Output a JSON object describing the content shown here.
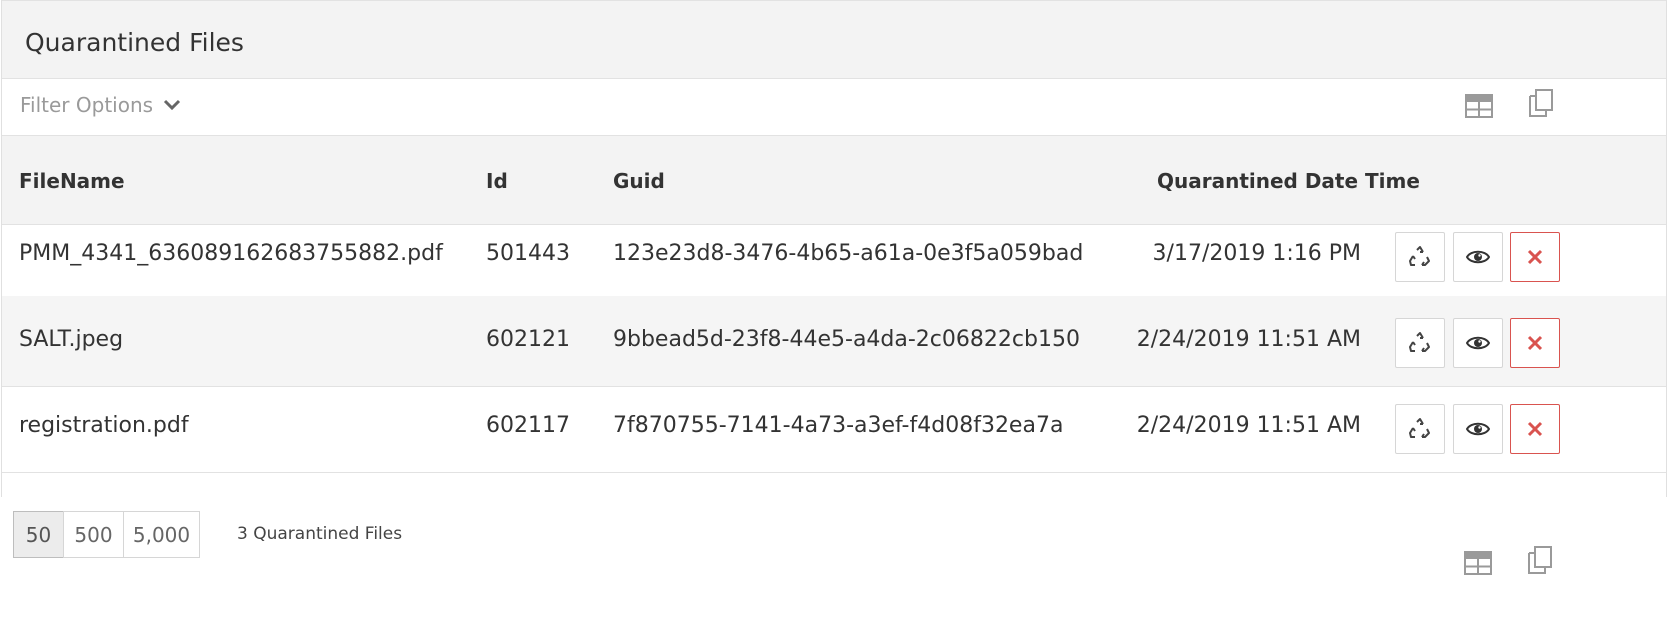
{
  "panel": {
    "title": "Quarantined Files",
    "filter_label": "Filter Options"
  },
  "table": {
    "columns": {
      "filename": "FileName",
      "id": "Id",
      "guid": "Guid",
      "date": "Quarantined Date Time"
    },
    "rows": [
      {
        "filename": "PMM_4341_636089162683755882.pdf",
        "id": "501443",
        "guid": "123e23d8-3476-4b65-a61a-0e3f5a059bad",
        "date": "3/17/2019 1:16 PM"
      },
      {
        "filename": "SALT.jpeg",
        "id": "602121",
        "guid": "9bbead5d-23f8-44e5-a4da-2c06822cb150",
        "date": "2/24/2019 11:51 AM"
      },
      {
        "filename": "registration.pdf",
        "id": "602117",
        "guid": "7f870755-7141-4a73-a3ef-f4d08f32ea7a",
        "date": "2/24/2019 11:51 AM"
      }
    ]
  },
  "pager": {
    "sizes": [
      "50",
      "500",
      "5,000"
    ],
    "active_size": "50",
    "count_text": "3 Quarantined Files"
  },
  "icons": {
    "chevron": "chevron-down-icon",
    "grid": "table-icon",
    "copy": "copy-icon",
    "restore": "recycle-icon",
    "view": "eye-icon",
    "delete": "close-icon"
  },
  "colors": {
    "header_bg": "#f3f3f3",
    "delete_red": "#d9534f",
    "icon_gray": "#9a9a9a"
  }
}
